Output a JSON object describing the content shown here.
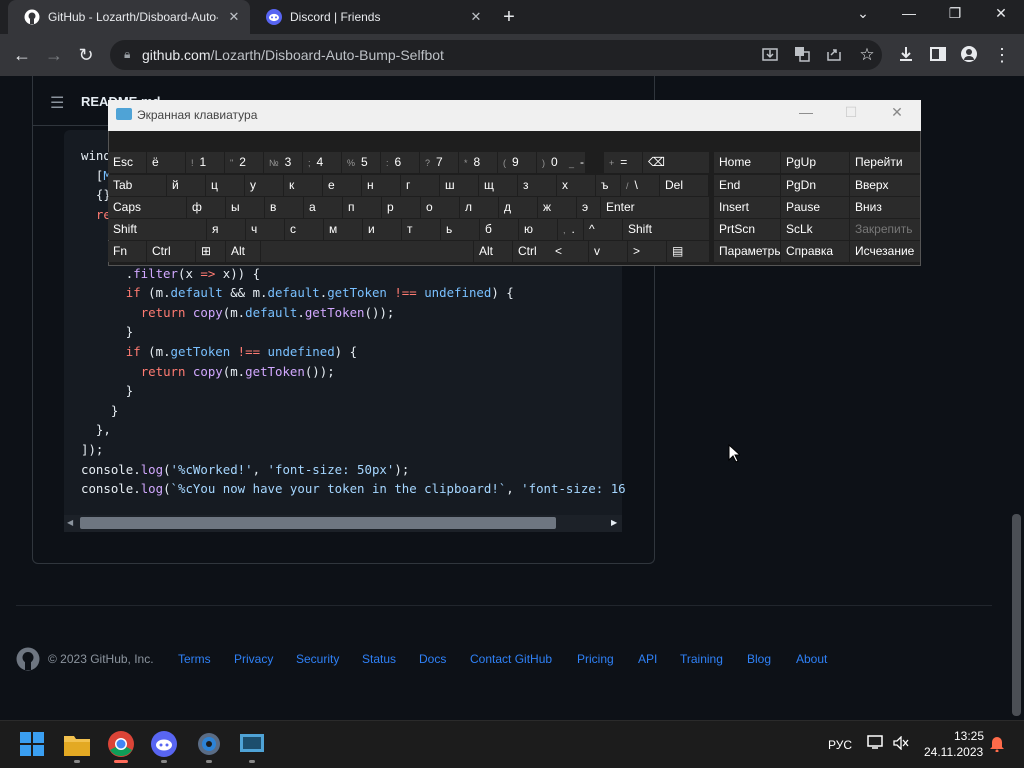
{
  "browser": {
    "tabs": [
      {
        "title": "GitHub - Lozarth/Disboard-Auto-Bump-Selfbot",
        "close": "✕"
      },
      {
        "title": "Discord | Friends",
        "close": "✕"
      }
    ],
    "new_tab": "+",
    "window_controls": {
      "dropdown": "⌄",
      "minimize": "—",
      "restore": "❐",
      "close": "✕"
    },
    "url_domain": "github.com",
    "url_path": "/Lozarth/Disboard-Auto-Bump-Selfbot",
    "nav": {
      "back": "←",
      "forward": "→",
      "reload": "↻"
    }
  },
  "readme": {
    "title": "README.md"
  },
  "code_lines": [
    [
      [
        "wind",
        "t"
      ]
    ],
    [
      [
        "  [",
        "t"
      ],
      [
        "M",
        "p"
      ]
    ],
    [
      [
        "  {}",
        "t"
      ]
    ],
    [
      [
        "  re",
        "k"
      ]
    ],
    [
      [
        "",
        ""
      ]
    ],
    [
      [
        "",
        ""
      ]
    ],
    [
      [
        "      .",
        "t"
      ],
      [
        "filter",
        "f"
      ],
      [
        "(x ",
        "t"
      ],
      [
        "=>",
        "k"
      ],
      [
        " x)) {",
        "t"
      ]
    ],
    [
      [
        "      ",
        "t"
      ],
      [
        "if",
        "k"
      ],
      [
        " (m.",
        "t"
      ],
      [
        "default",
        "p"
      ],
      [
        " && m.",
        "t"
      ],
      [
        "default",
        "p"
      ],
      [
        ".",
        "t"
      ],
      [
        "getToken",
        "p"
      ],
      [
        " !== ",
        "k"
      ],
      [
        "undefined",
        "p"
      ],
      [
        ") {",
        "t"
      ]
    ],
    [
      [
        "        ",
        "t"
      ],
      [
        "return",
        "k"
      ],
      [
        " ",
        "t"
      ],
      [
        "copy",
        "f"
      ],
      [
        "(m.",
        "t"
      ],
      [
        "default",
        "p"
      ],
      [
        ".",
        "t"
      ],
      [
        "getToken",
        "f"
      ],
      [
        "());",
        "t"
      ]
    ],
    [
      [
        "      }",
        "t"
      ]
    ],
    [
      [
        "      ",
        "t"
      ],
      [
        "if",
        "k"
      ],
      [
        " (m.",
        "t"
      ],
      [
        "getToken",
        "p"
      ],
      [
        " !== ",
        "k"
      ],
      [
        "undefined",
        "p"
      ],
      [
        ") {",
        "t"
      ]
    ],
    [
      [
        "        ",
        "t"
      ],
      [
        "return",
        "k"
      ],
      [
        " ",
        "t"
      ],
      [
        "copy",
        "f"
      ],
      [
        "(m.",
        "t"
      ],
      [
        "getToken",
        "f"
      ],
      [
        "());",
        "t"
      ]
    ],
    [
      [
        "      }",
        "t"
      ]
    ],
    [
      [
        "    }",
        "t"
      ]
    ],
    [
      [
        "  },",
        "t"
      ]
    ],
    [
      [
        "]);",
        "t"
      ]
    ],
    [
      [
        "console.",
        "t"
      ],
      [
        "log",
        "f"
      ],
      [
        "(",
        "t"
      ],
      [
        "'%cWorked!'",
        "s"
      ],
      [
        ", ",
        "t"
      ],
      [
        "'font-size: 50px'",
        "s"
      ],
      [
        ");",
        "t"
      ]
    ],
    [
      [
        "console.",
        "t"
      ],
      [
        "log",
        "f"
      ],
      [
        "(",
        "t"
      ],
      [
        "`%cYou now have your token in the clipboard!`",
        "s"
      ],
      [
        ", ",
        "t"
      ],
      [
        "'font-size: 16",
        "s"
      ]
    ]
  ],
  "footer": {
    "copyright": "© 2023 GitHub, Inc.",
    "links": [
      "Terms",
      "Privacy",
      "Security",
      "Status",
      "Docs",
      "Contact GitHub",
      "Pricing",
      "API",
      "Training",
      "Blog",
      "About"
    ]
  },
  "osk": {
    "title": "Экранная клавиатура",
    "rows": [
      [
        {
          "l": "Esc"
        },
        {
          "l": "ё"
        },
        {
          "s": "!",
          "l": "1"
        },
        {
          "s": "\"",
          "l": "2"
        },
        {
          "s": "№",
          "l": "3"
        },
        {
          "s": ";",
          "l": "4"
        },
        {
          "s": "%",
          "l": "5"
        },
        {
          "s": ":",
          "l": "6"
        },
        {
          "s": "?",
          "l": "7"
        },
        {
          "s": "*",
          "l": "8"
        },
        {
          "s": "(",
          "l": "9"
        },
        {
          "s": ")",
          "l": "0"
        },
        {
          "s": "_",
          "l": "-"
        },
        {
          "s": "+",
          "l": "="
        },
        {
          "l": "⌫"
        }
      ],
      [
        {
          "l": "Tab"
        },
        {
          "l": "й"
        },
        {
          "l": "ц"
        },
        {
          "l": "у"
        },
        {
          "l": "к"
        },
        {
          "l": "е"
        },
        {
          "l": "н"
        },
        {
          "l": "г"
        },
        {
          "l": "ш"
        },
        {
          "l": "щ"
        },
        {
          "l": "з"
        },
        {
          "l": "х"
        },
        {
          "l": "ъ"
        },
        {
          "s": "/",
          "l": "\\"
        },
        {
          "l": "Del"
        }
      ],
      [
        {
          "l": "Caps"
        },
        {
          "l": "ф"
        },
        {
          "l": "ы"
        },
        {
          "l": "в"
        },
        {
          "l": "а"
        },
        {
          "l": "п"
        },
        {
          "l": "р"
        },
        {
          "l": "о"
        },
        {
          "l": "л"
        },
        {
          "l": "д"
        },
        {
          "l": "ж"
        },
        {
          "l": "э"
        },
        {
          "l": "Enter"
        }
      ],
      [
        {
          "l": "Shift"
        },
        {
          "l": "я"
        },
        {
          "l": "ч"
        },
        {
          "l": "с"
        },
        {
          "l": "м"
        },
        {
          "l": "и"
        },
        {
          "l": "т"
        },
        {
          "l": "ь"
        },
        {
          "l": "б"
        },
        {
          "l": "ю"
        },
        {
          "s": ",",
          "l": "."
        },
        {
          "l": "^"
        },
        {
          "l": "Shift"
        }
      ],
      [
        {
          "l": "Fn"
        },
        {
          "l": "Ctrl"
        },
        {
          "l": "⊞"
        },
        {
          "l": "Alt"
        },
        {
          "l": ""
        },
        {
          "l": "Alt"
        },
        {
          "l": "Ctrl"
        },
        {
          "l": "<"
        },
        {
          "l": "v"
        },
        {
          "l": ">"
        },
        {
          "l": "▤"
        }
      ]
    ],
    "side": [
      [
        "Home",
        "PgUp",
        "Перейти"
      ],
      [
        "End",
        "PgDn",
        "Вверх"
      ],
      [
        "Insert",
        "Pause",
        "Вниз"
      ],
      [
        "PrtScn",
        "ScLk",
        "Закрепить"
      ],
      [
        "Параметры",
        "Справка",
        "Исчезание"
      ]
    ]
  },
  "taskbar": {
    "lang": "РУС",
    "time": "13:25",
    "date": "24.11.2023"
  }
}
